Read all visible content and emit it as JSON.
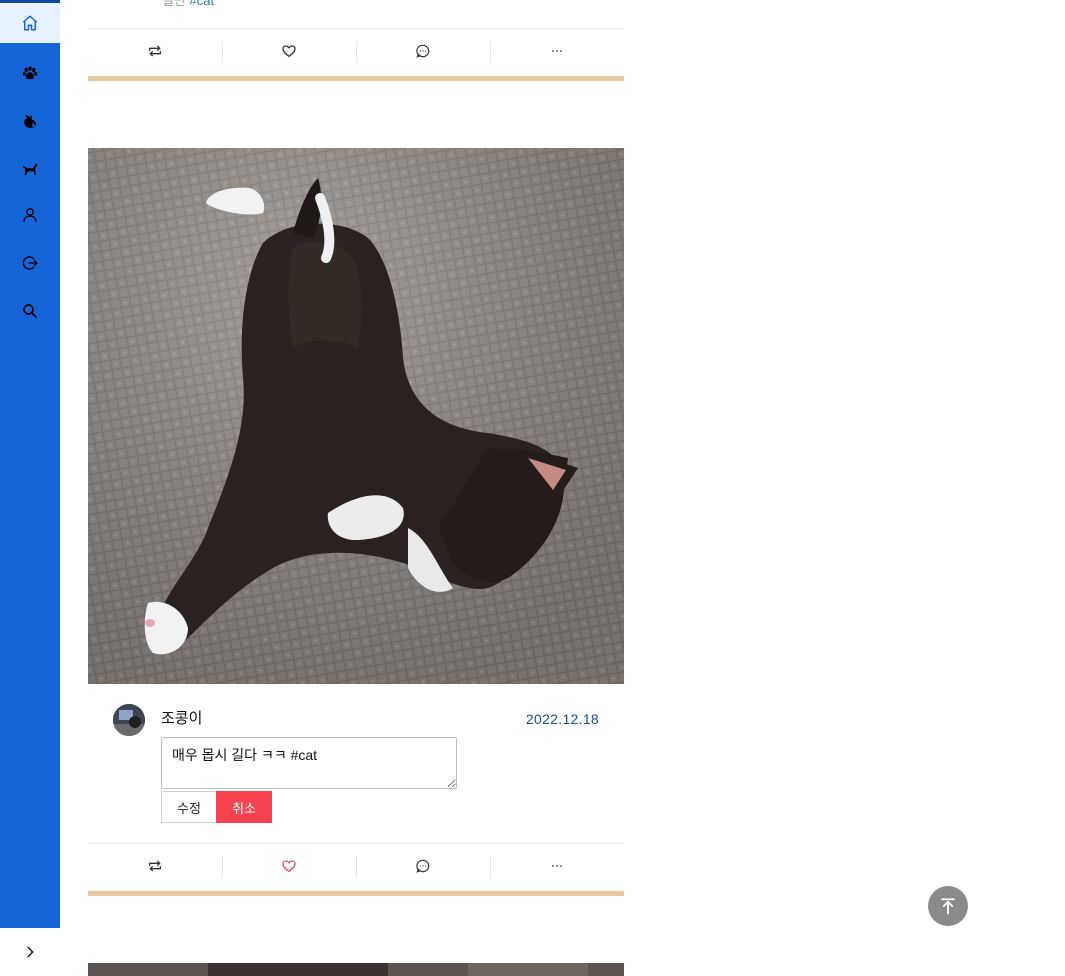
{
  "sidebar": {
    "items": [
      {
        "name": "home",
        "icon": "home-icon",
        "active": true
      },
      {
        "name": "paw",
        "icon": "paw-icon"
      },
      {
        "name": "cat",
        "icon": "cat-icon"
      },
      {
        "name": "dog",
        "icon": "dog-icon"
      },
      {
        "name": "profile",
        "icon": "user-icon"
      },
      {
        "name": "logout",
        "icon": "logout-icon"
      },
      {
        "name": "search",
        "icon": "search-icon"
      }
    ],
    "expand_icon": "chevron-right-icon",
    "color": "#1565d8"
  },
  "previous_post": {
    "caption_prefix": "길단",
    "caption_tag": "#cat",
    "actions": [
      "repost-icon",
      "heart-icon",
      "comment-icon",
      "more-icon"
    ]
  },
  "post": {
    "author": "조콩이",
    "date": "2022.12.18",
    "edit_text": "매우 몹시 길다 ㅋㅋ #cat",
    "edit_button": "수정",
    "cancel_button": "취소",
    "liked": true,
    "actions": [
      "repost-icon",
      "heart-icon",
      "comment-icon",
      "more-icon"
    ]
  },
  "colors": {
    "accent": "#1565d8",
    "divider": "#e6c9a0",
    "cancel": "#f7424f",
    "liked_heart": "#e8457a",
    "date": "#1a4a8a"
  },
  "scroll_top_icon": "arrow-up-to-line-icon"
}
